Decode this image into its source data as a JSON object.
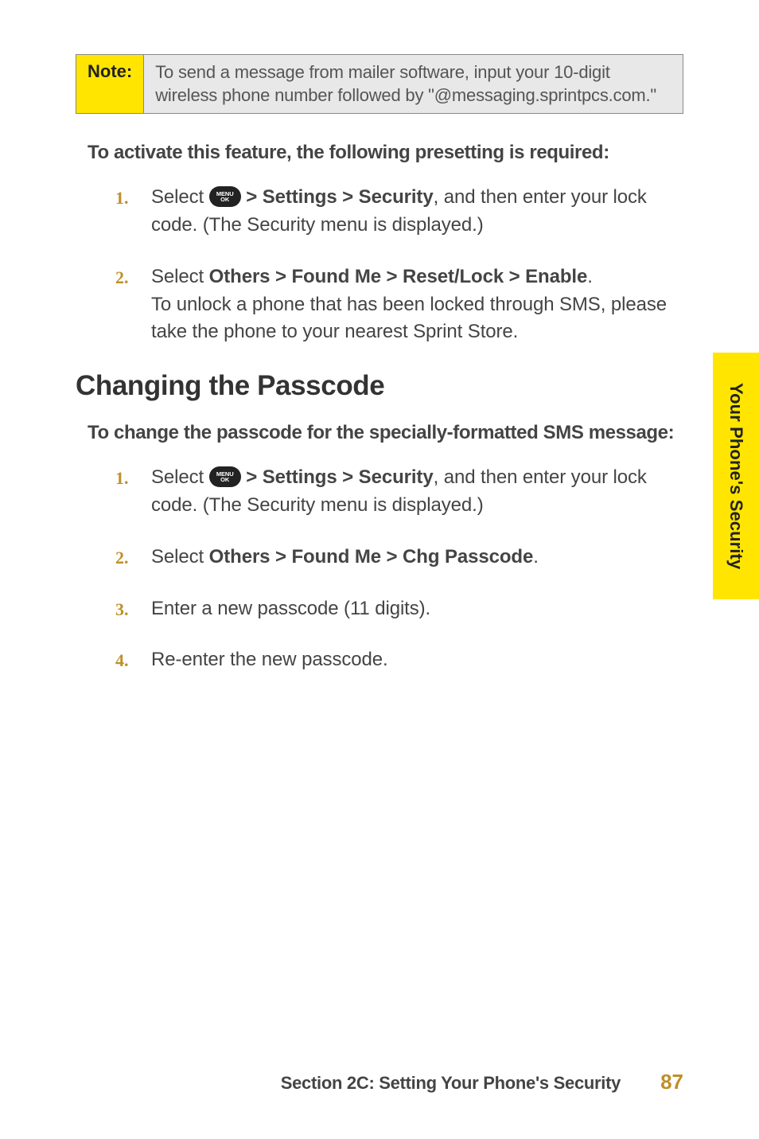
{
  "note": {
    "label": "Note:",
    "text": "To send a message from mailer software, input your 10-digit wireless phone number followed by \"@messaging.sprintpcs.com.\""
  },
  "section1": {
    "heading": "To activate this feature, the following presetting is required:",
    "steps": [
      {
        "num": "1.",
        "prefix": "Select ",
        "icon": "menu-ok-icon",
        "icon_label_top": "MENU",
        "icon_label_bottom": "OK",
        "mid": " ",
        "bold": "> Settings > Security",
        "suffix": ", and then enter your lock code. (The Security menu is displayed.)"
      },
      {
        "num": "2.",
        "prefix": "Select ",
        "bold": "Others > Found Me > Reset/Lock > Enable",
        "suffix2": ".",
        "after": "To unlock a phone that has been locked through SMS, please take the phone to your nearest Sprint Store."
      }
    ]
  },
  "h2": "Changing the Passcode",
  "section2": {
    "heading": "To change the passcode for the specially-formatted SMS message:",
    "steps": [
      {
        "num": "1.",
        "prefix": "Select ",
        "icon": "menu-ok-icon",
        "icon_label_top": "MENU",
        "icon_label_bottom": "OK",
        "mid": " ",
        "bold": "> Settings > Security",
        "suffix": ", and then enter your lock code. (The Security menu is displayed.)"
      },
      {
        "num": "2.",
        "prefix": "Select ",
        "bold": "Others > Found Me > Chg Passcode",
        "suffix2": "."
      },
      {
        "num": "3.",
        "plain": "Enter a new passcode (11 digits)."
      },
      {
        "num": "4.",
        "plain": "Re-enter the new passcode."
      }
    ]
  },
  "side_tab": "Your Phone's Security",
  "footer": {
    "section": "Section 2C: Setting Your Phone's Security",
    "page": "87"
  }
}
